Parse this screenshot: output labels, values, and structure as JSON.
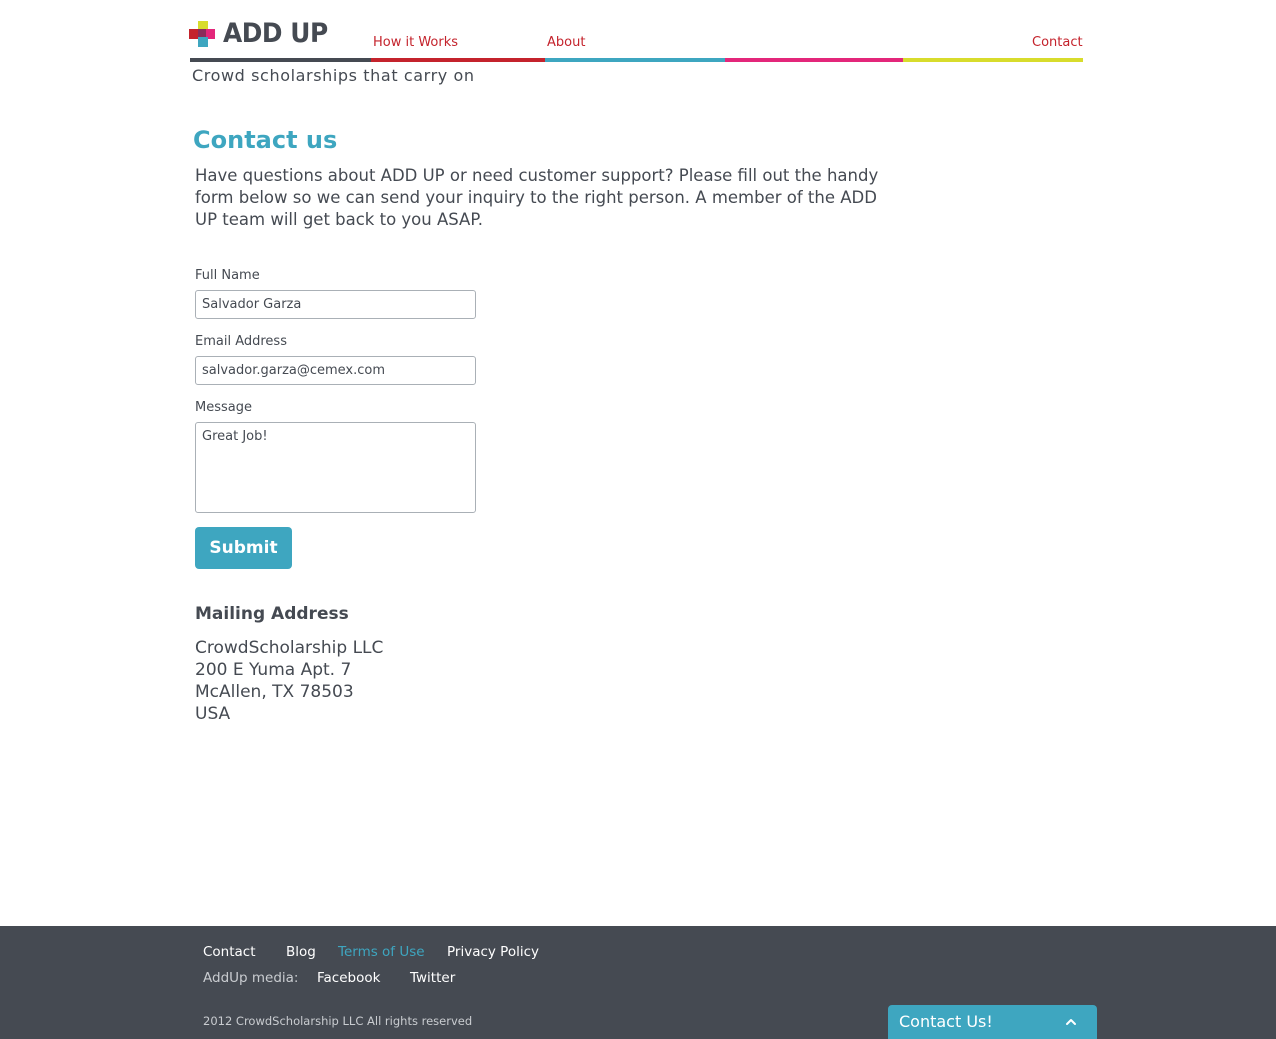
{
  "brand": {
    "logo_text": "ADD UP",
    "tagline": "Crowd scholarships that carry on",
    "colors": {
      "dark": "#454a52",
      "red": "#c4232c",
      "teal": "#3ea6c0",
      "pink": "#e3267a",
      "yellow": "#d8dc2c"
    }
  },
  "nav": {
    "how_it_works": "How it Works",
    "about": "About",
    "contact": "Contact"
  },
  "main": {
    "title": "Contact us",
    "intro": "Have questions about ADD UP or need customer support? Please fill out the handy form below so we can send your inquiry to the right person. A member of the ADD UP team will get back to you ASAP.",
    "form": {
      "name_label": "Full Name",
      "name_value": "Salvador Garza",
      "email_label": "Email Address",
      "email_value": "salvador.garza@cemex.com",
      "message_label": "Message",
      "message_value": "Great Job!",
      "submit_label": "Submit"
    },
    "mailing": {
      "heading": "Mailing Address",
      "lines": [
        "CrowdScholarship LLC",
        "200 E Yuma Apt. 7",
        "McAllen, TX 78503",
        "USA"
      ]
    }
  },
  "footer": {
    "contact": "Contact",
    "blog": "Blog",
    "terms": "Terms of Use",
    "privacy": "Privacy Policy",
    "media_label": "AddUp media:",
    "facebook": "Facebook",
    "twitter": "Twitter",
    "copyright": "2012 CrowdScholarship LLC All rights reserved"
  },
  "contact_widget": {
    "label": "Contact Us!",
    "icon": "chevron-up-icon"
  }
}
